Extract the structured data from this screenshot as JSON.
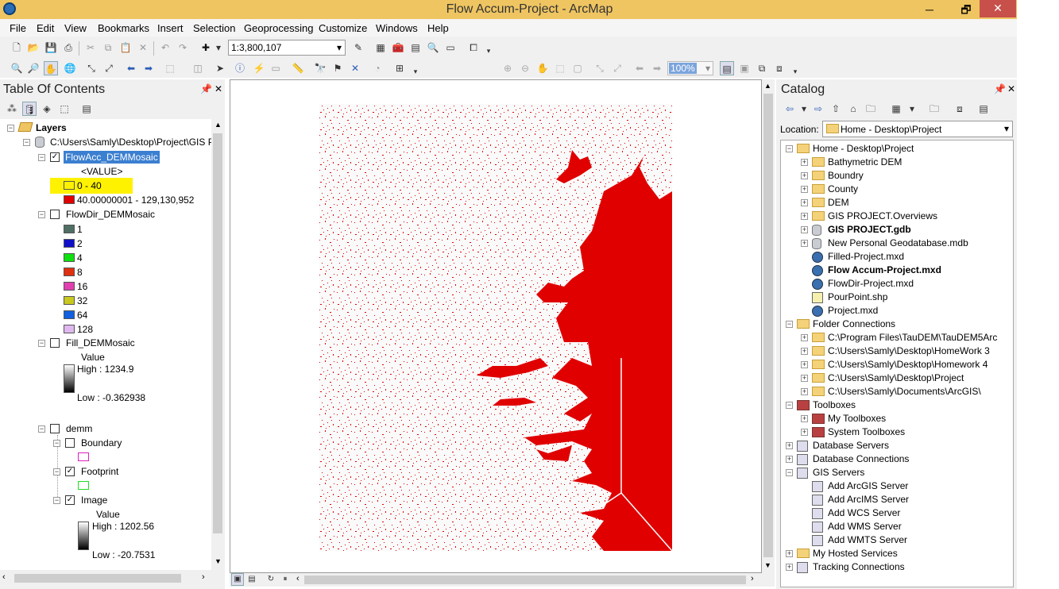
{
  "window": {
    "title": "Flow Accum-Project - ArcMap",
    "min": "─",
    "max": "🗗",
    "close": "✕"
  },
  "menu": [
    "File",
    "Edit",
    "View",
    "Bookmarks",
    "Insert",
    "Selection",
    "Geoprocessing",
    "Customize",
    "Windows",
    "Help"
  ],
  "toolbar": {
    "scale": "1:3,800,107",
    "zoom_pct": "100%"
  },
  "toc": {
    "title": "Table Of Contents",
    "layers": "Layers",
    "path": "C:\\Users\\Samly\\Desktop\\Project\\GIS P",
    "flowacc": {
      "name": "FlowAcc_DEMMosaic",
      "field": "<VALUE>",
      "class1": "0 - 40",
      "class2": "40.00000001 - 129,130,952",
      "class2_color": "#e00000"
    },
    "flowdir": {
      "name": "FlowDir_DEMMosaic",
      "classes": [
        {
          "label": "1",
          "color": "#4f6f63"
        },
        {
          "label": "2",
          "color": "#1010c8"
        },
        {
          "label": "4",
          "color": "#10e010"
        },
        {
          "label": "8",
          "color": "#e03010"
        },
        {
          "label": "16",
          "color": "#e040b0"
        },
        {
          "label": "32",
          "color": "#c8c820"
        },
        {
          "label": "64",
          "color": "#1060e0"
        },
        {
          "label": "128",
          "color": "#e0b8f0"
        }
      ]
    },
    "fill": {
      "name": "Fill_DEMMosaic",
      "value": "Value",
      "high": "High : 1234.9",
      "low": "Low : -0.362938"
    },
    "demm": {
      "name": "demm",
      "boundary": "Boundary",
      "footprint": "Footprint",
      "image": "Image",
      "value": "Value",
      "high": "High : 1202.56",
      "low": "Low : -20.7531"
    }
  },
  "catalog": {
    "title": "Catalog",
    "location_label": "Location:",
    "location_value": "Home - Desktop\\Project",
    "home": "Home - Desktop\\Project",
    "home_items": [
      {
        "label": "Bathymetric DEM",
        "type": "folder"
      },
      {
        "label": "Boundry",
        "type": "folder"
      },
      {
        "label": "County",
        "type": "folder"
      },
      {
        "label": "DEM",
        "type": "folder"
      },
      {
        "label": "GIS PROJECT.Overviews",
        "type": "folder"
      },
      {
        "label": "GIS PROJECT.gdb",
        "type": "gdb",
        "bold": true
      },
      {
        "label": "New Personal Geodatabase.mdb",
        "type": "gdb"
      },
      {
        "label": "Filled-Project.mxd",
        "type": "mxd"
      },
      {
        "label": "Flow Accum-Project.mxd",
        "type": "mxd",
        "bold": true
      },
      {
        "label": "FlowDir-Project.mxd",
        "type": "mxd"
      },
      {
        "label": "PourPoint.shp",
        "type": "shp"
      },
      {
        "label": "Project.mxd",
        "type": "mxd"
      }
    ],
    "folder_connections": "Folder Connections",
    "connections": [
      "C:\\Program Files\\TauDEM\\TauDEM5Arc",
      "C:\\Users\\Samly\\Desktop\\HomeWork 3",
      "C:\\Users\\Samly\\Desktop\\Homework 4",
      "C:\\Users\\Samly\\Desktop\\Project",
      "C:\\Users\\Samly\\Documents\\ArcGIS\\"
    ],
    "toolboxes": "Toolboxes",
    "toolbox_items": [
      "My Toolboxes",
      "System Toolboxes"
    ],
    "database_servers": "Database Servers",
    "database_connections": "Database Connections",
    "gis_servers": "GIS Servers",
    "server_items": [
      "Add ArcGIS Server",
      "Add ArcIMS Server",
      "Add WCS Server",
      "Add WMS Server",
      "Add WMTS Server"
    ],
    "hosted": "My Hosted Services",
    "tracking": "Tracking Connections"
  }
}
